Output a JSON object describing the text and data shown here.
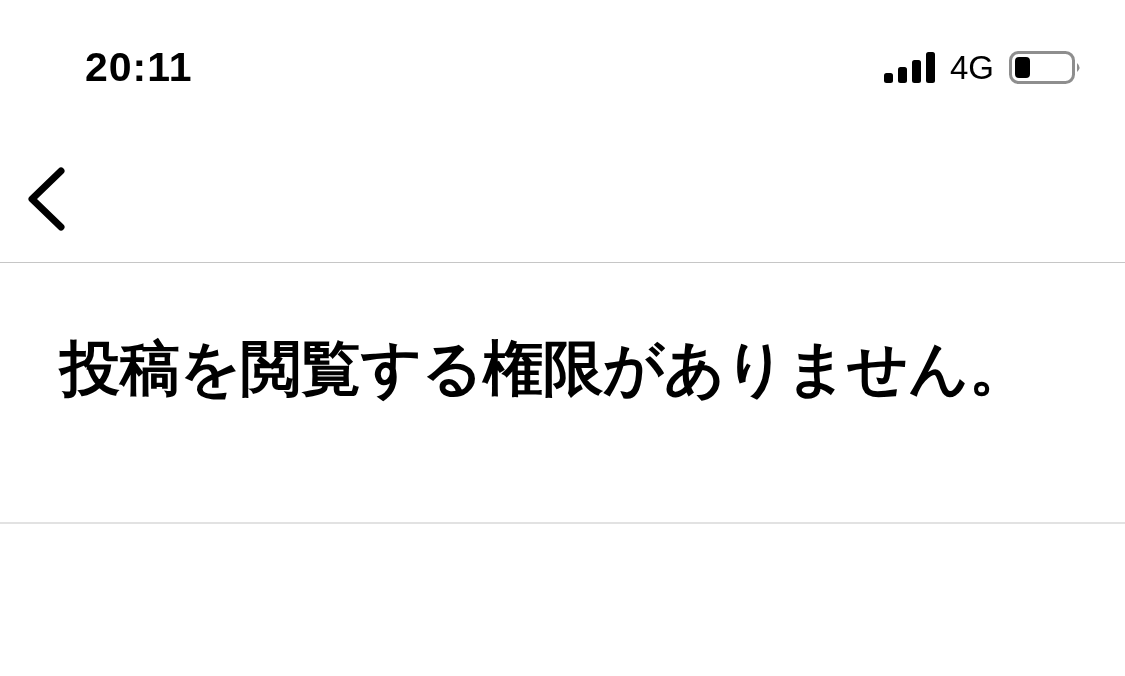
{
  "status_bar": {
    "time": "20:11",
    "network": "4G"
  },
  "message": "投稿を閲覧する権限がありません。"
}
